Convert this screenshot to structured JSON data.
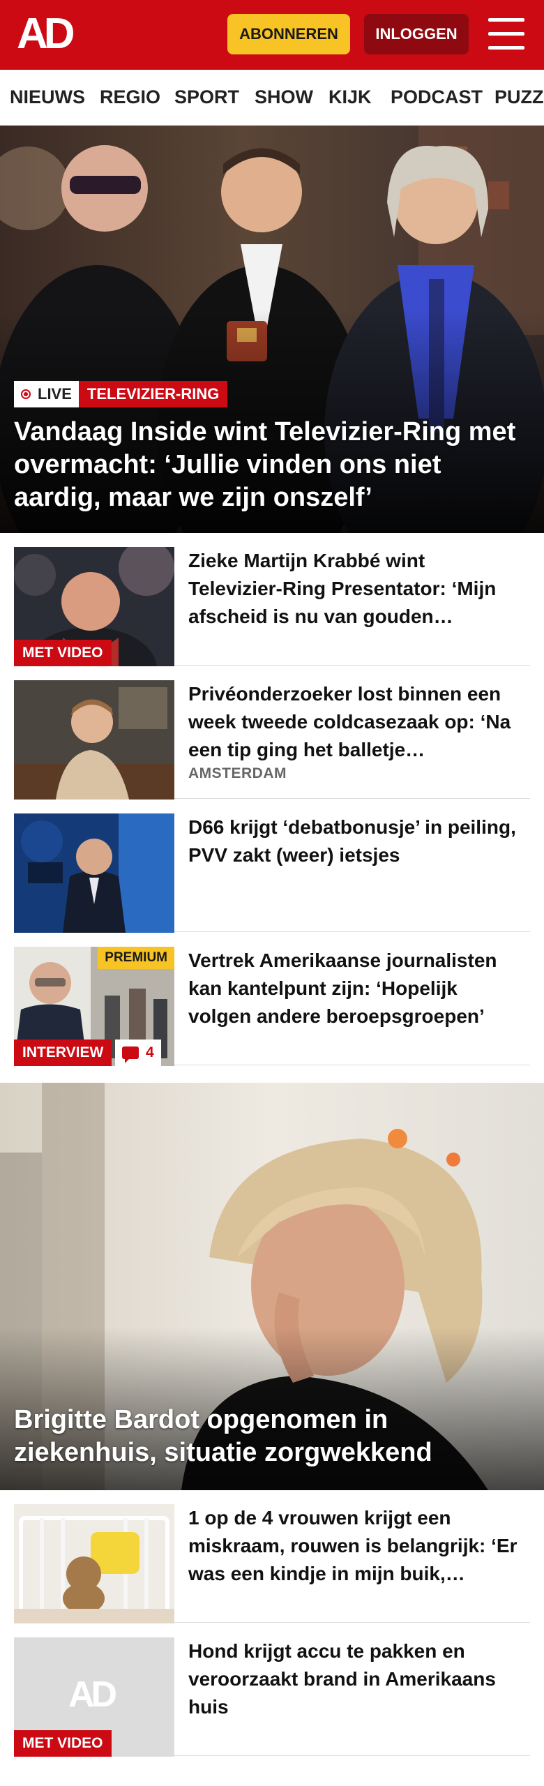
{
  "header": {
    "logo": "AD",
    "subscribe_label": "ABONNEREN",
    "login_label": "INLOGGEN",
    "colors": {
      "brand": "#cc0a14",
      "subscribe": "#f7c325",
      "login": "#8f0a10"
    }
  },
  "nav": {
    "items": [
      "NIEUWS",
      "REGIO",
      "SPORT",
      "SHOW",
      "KIJK",
      "PODCAST",
      "PUZZ"
    ]
  },
  "hero": {
    "live_label": "LIVE",
    "category": "TELEVIZIER-RING",
    "title": "Vandaag Inside wint Televizier-Ring met overmacht: ‘Jullie vinden ons niet aardig, maar we zijn onszelf’"
  },
  "articles": [
    {
      "title": "Zieke Martijn Krabbé wint Televizier-Ring Presentator: ‘Mijn afscheid is nu van gouden…",
      "tag": "MET VIDEO"
    },
    {
      "title": "Privéonderzoeker lost binnen een week tweede coldcasezaak op: ‘Na een tip ging het balletje…",
      "location": "AMSTERDAM"
    },
    {
      "title": "D66 krijgt ‘debatbonusje’ in peiling, PVV zakt (weer) ietsjes"
    },
    {
      "title": "Vertrek Amerikaanse journalisten kan kantelpunt zijn: ‘Hopelijk volgen andere beroepsgroepen’",
      "tag": "INTERVIEW",
      "premium": "PREMIUM",
      "comments": "4"
    }
  ],
  "hero2": {
    "title": "Brigitte Bardot opgenomen in ziekenhuis, situatie zorgwekkend"
  },
  "articles2": [
    {
      "title": "1 op de 4 vrouwen krijgt een miskraam, rouwen is belangrijk: ‘Er was een kindje in mijn buik,…"
    },
    {
      "title": "Hond krijgt accu te pakken en veroorzaakt brand in Amerikaans huis",
      "tag": "MET VIDEO",
      "placeholder_logo": "AD"
    }
  ]
}
